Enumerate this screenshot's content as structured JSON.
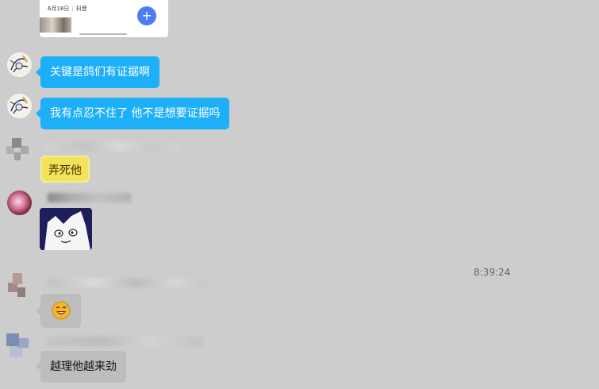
{
  "share_card": {
    "date": "6月18日",
    "app": "抖音",
    "plus_label": "+"
  },
  "messages": [
    {
      "text": "关键是鸽们有证据啊"
    },
    {
      "text": "我有点忍不住了 他不是想要证据吗"
    },
    {
      "text": "弄死他"
    },
    {
      "sticker": "cartoon-cat-face-sticker"
    },
    {
      "emoji": "😅"
    },
    {
      "text": "越理他越来劲"
    }
  ],
  "timestamp": "8:39:24",
  "colors": {
    "background": "#cdcdcd",
    "bubble_blue": "#1db0f8",
    "bubble_gray": "#bdbdbd",
    "bubble_yellow": "#f6e25a",
    "plus_button": "#4d7cf5"
  }
}
